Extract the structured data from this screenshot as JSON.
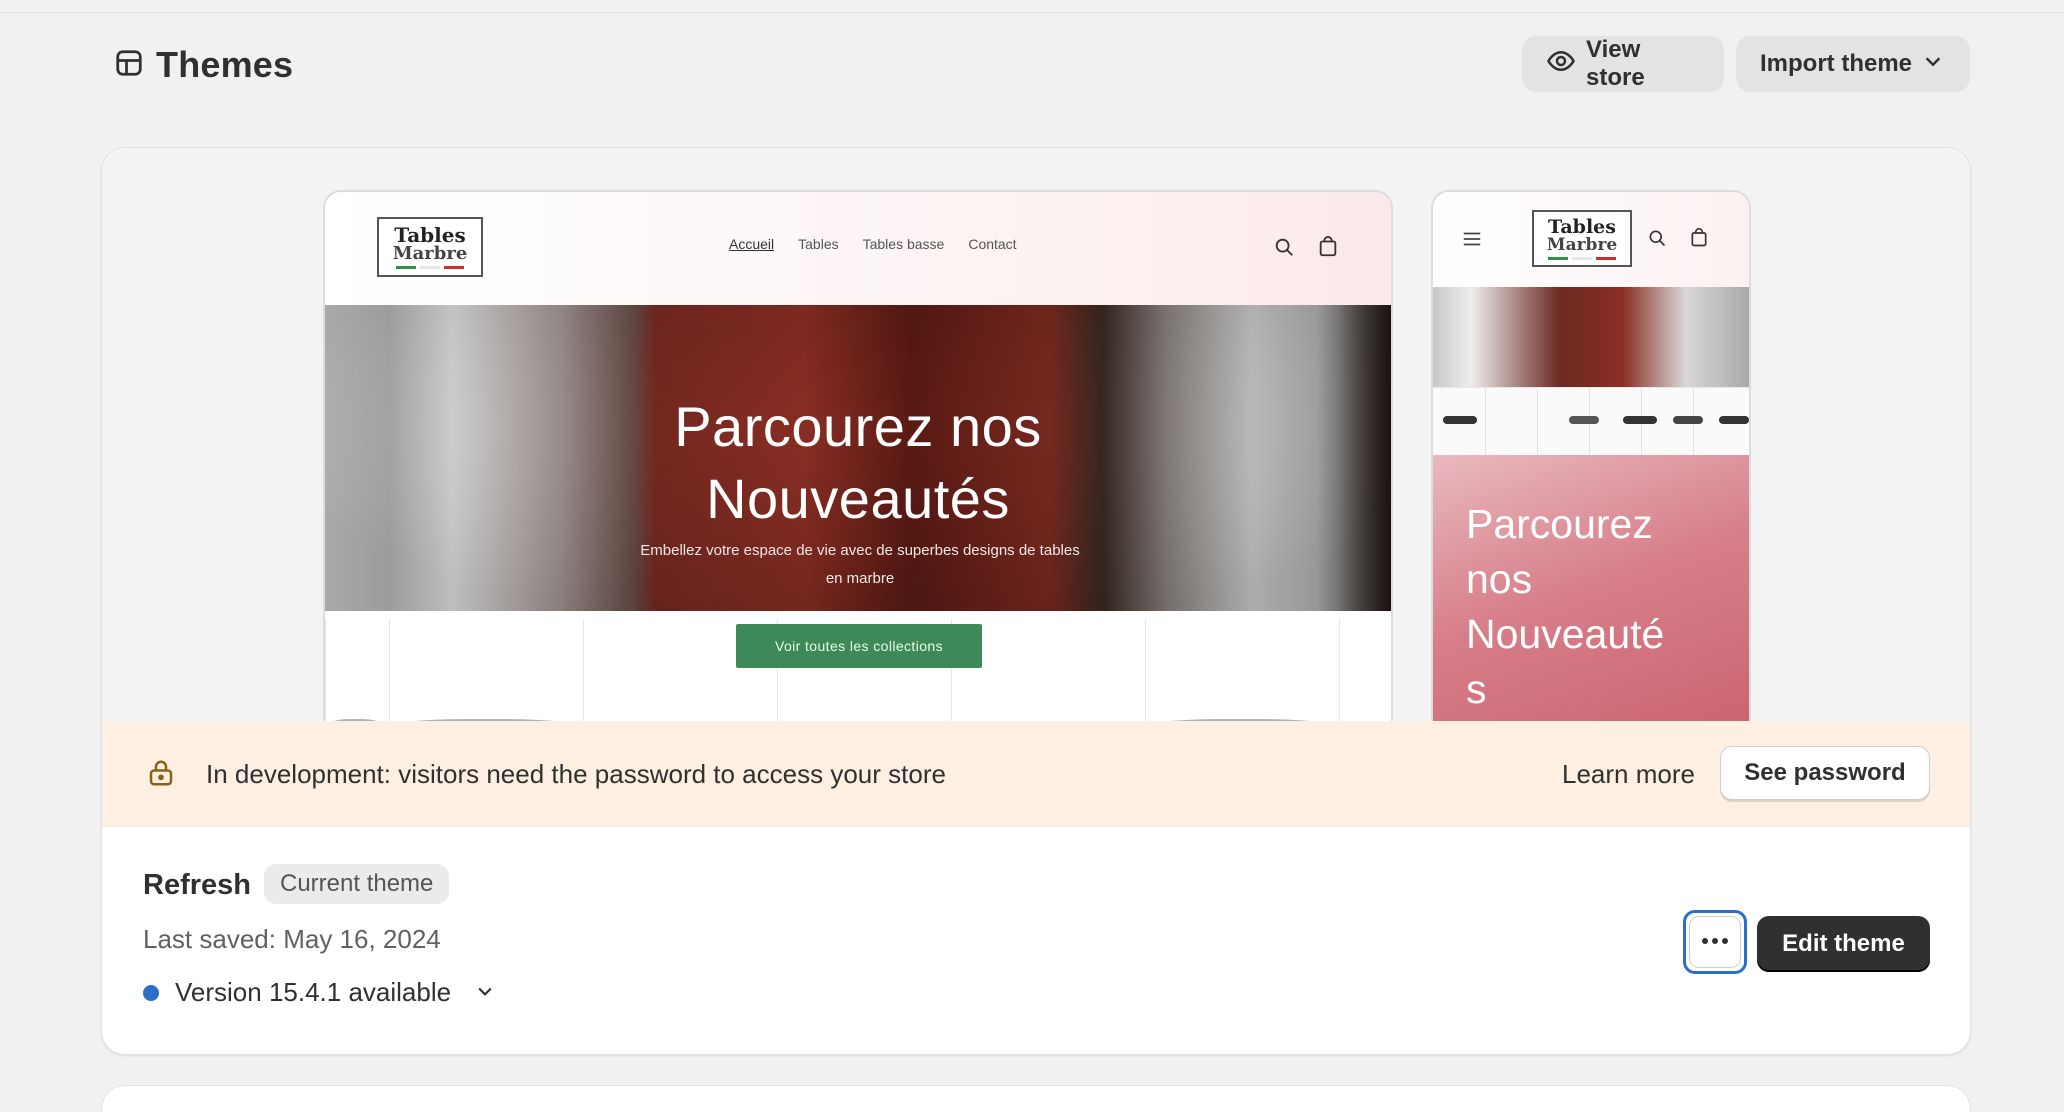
{
  "header": {
    "title": "Themes",
    "title_icon": "theme-icon",
    "view_store": "View store",
    "view_store_icon": "eye-icon",
    "import_theme": "Import theme",
    "import_theme_icon": "chevron-down-icon"
  },
  "preview": {
    "desktop": {
      "logo_line1": "Tables",
      "logo_line2": "Marbre",
      "nav_links": [
        "Accueil",
        "Tables",
        "Tables basse",
        "Contact"
      ],
      "icons": [
        "search-icon",
        "cart-icon"
      ],
      "hero_title_line1": "Parcourez nos",
      "hero_title_line2": "Nouveautés",
      "hero_subtitle": "Embellez votre espace de vie avec de superbes designs de tables en marbre",
      "cta_label": "Voir toutes les collections"
    },
    "mobile": {
      "logo_line1": "Tables",
      "logo_line2": "Marbre",
      "icons": [
        "menu-icon",
        "search-icon",
        "cart-icon"
      ],
      "hero_text": "Parcourez\nnos\nNouveauté\ns"
    }
  },
  "banner": {
    "icon": "lock-icon",
    "message": "In development: visitors need the password to access your store",
    "learn_more": "Learn more",
    "see_password": "See password"
  },
  "theme": {
    "name": "Refresh",
    "badge": "Current theme",
    "last_saved": "Last saved: May 16, 2024",
    "version": "Version 15.4.1 available",
    "more_icon": "more-horizontal-icon",
    "edit_label": "Edit theme"
  },
  "colors": {
    "accent": "#2c6ecb",
    "primary_button": "#303030",
    "banner_bg": "#fdf0e3",
    "cta_green": "#3d8a58"
  }
}
